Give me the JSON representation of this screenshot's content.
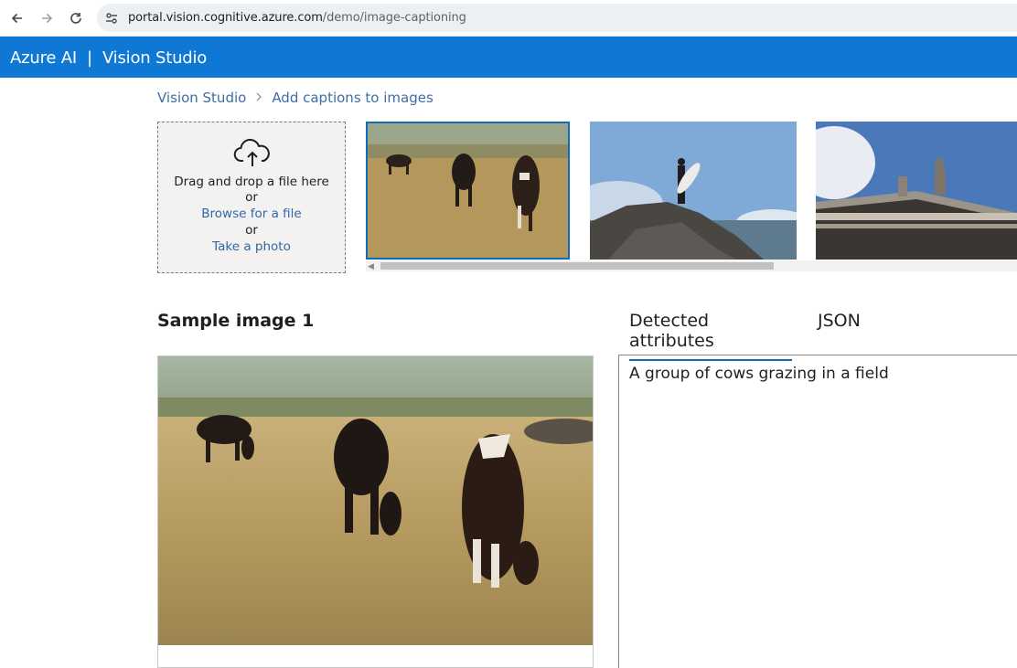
{
  "browser": {
    "url_domain": "portal.vision.cognitive.azure.com",
    "url_path": "/demo/image-captioning"
  },
  "header": {
    "title": "Azure AI  |  Vision Studio",
    "brand_color": "#0f78d4"
  },
  "breadcrumb": {
    "items": [
      "Vision Studio",
      "Add captions to images"
    ],
    "separator": ">"
  },
  "upload": {
    "icon": "cloud-upload-icon",
    "line1": "Drag and drop a file here",
    "or1": "or",
    "browse_link": "Browse for a file",
    "or2": "or",
    "photo_link": "Take a photo"
  },
  "thumbnails": [
    {
      "name": "cows-grazing",
      "selected": true
    },
    {
      "name": "surfer-on-rock",
      "selected": false
    },
    {
      "name": "building-statues",
      "selected": false
    }
  ],
  "sample": {
    "title": "Sample image 1"
  },
  "tabs": [
    {
      "label": "Detected attributes",
      "active": true
    },
    {
      "label": "JSON",
      "active": false
    }
  ],
  "result": {
    "caption": "A group of cows grazing in a field"
  }
}
